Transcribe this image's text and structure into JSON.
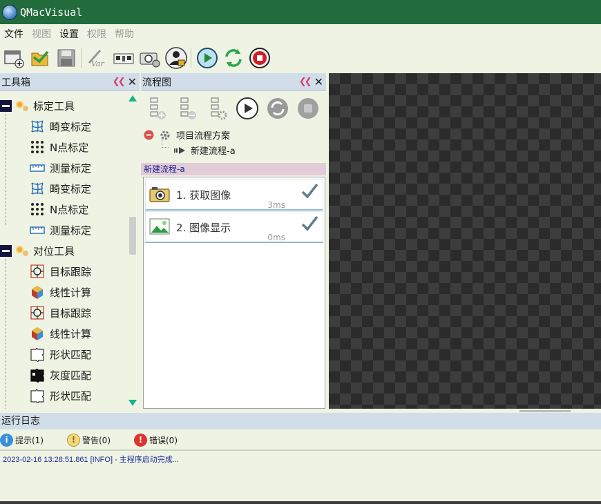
{
  "app": {
    "title": "QMacVisual"
  },
  "menu": [
    {
      "label": "文件",
      "enabled": true
    },
    {
      "label": "视图",
      "enabled": false
    },
    {
      "label": "设置",
      "enabled": true
    },
    {
      "label": "权限",
      "enabled": false
    },
    {
      "label": "帮助",
      "enabled": false
    }
  ],
  "toolbar": {
    "buttons": [
      {
        "name": "new-project-icon"
      },
      {
        "name": "open-project-icon"
      },
      {
        "name": "save-project-icon"
      },
      {
        "name": "variables-icon"
      },
      {
        "name": "io-board-icon"
      },
      {
        "name": "camera-settings-icon"
      },
      {
        "name": "user-lock-icon"
      },
      {
        "name": "run-once-icon"
      },
      {
        "name": "run-loop-icon"
      },
      {
        "name": "stop-icon"
      }
    ]
  },
  "toolbox": {
    "title": "工具箱",
    "categories": [
      {
        "label": "标定工具",
        "items": [
          "畸变标定",
          "N点标定",
          "测量标定",
          "畸变标定",
          "N点标定",
          "测量标定"
        ]
      },
      {
        "label": "对位工具",
        "items": [
          "目标跟踪",
          "线性计算",
          "目标跟踪",
          "线性计算",
          "形状匹配",
          "灰度匹配",
          "形状匹配"
        ]
      }
    ]
  },
  "flow": {
    "title": "流程图",
    "solution_label": "项目流程方案",
    "flow_name": "新建流程-a",
    "tab_label": "新建流程-a",
    "steps": [
      {
        "label": "1. 获取图像",
        "time": "3ms",
        "ok": true
      },
      {
        "label": "2. 图像显示",
        "time": "0ms",
        "ok": true
      }
    ]
  },
  "log": {
    "title": "运行日志",
    "filters": {
      "info": "提示(1)",
      "warning": "警告(0)",
      "error": "错误(0)"
    },
    "lines": [
      "2023-02-16 13:28:51.861 [INFO]  -  主程序启动完成..."
    ]
  },
  "colors": {
    "titlebar": "#226b3c",
    "panel_header": "#d1dde9",
    "background": "#eef3e3",
    "flow_tab": "#e2ccd8",
    "log_text": "#1a2a9c"
  }
}
